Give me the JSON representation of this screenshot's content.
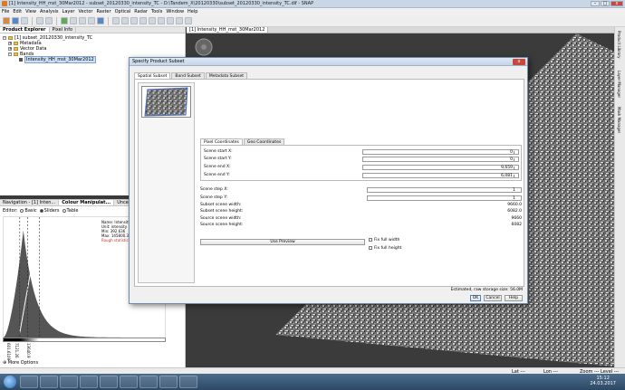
{
  "window": {
    "title": "[1] Intensity_HH_mst_30Mar2012 - subset_20120330_intensity_TC - D:\\Tandem_X\\20120330\\subset_20120330_intensity_TC.dif - SNAP",
    "min": "–",
    "max": "□",
    "close": "x"
  },
  "menu": [
    "File",
    "Edit",
    "View",
    "Analysis",
    "Layer",
    "Vector",
    "Raster",
    "Optical",
    "Radar",
    "Tools",
    "Window",
    "Help"
  ],
  "explorer": {
    "tabs": [
      "Product Explorer",
      "Pixel Info"
    ],
    "product": "[1] subset_20120330_intensity_TC",
    "metadata": "Metadata",
    "vector": "Vector Data",
    "bands": "Bands",
    "band": "Intensity_HH_mst_30Mar2012"
  },
  "colour": {
    "tabs": [
      "Navigation - [1] Inten...",
      "Colour Manipulat...",
      "Uncertainty Visuals..."
    ],
    "editor_label": "Editor:",
    "modes": [
      "Basic",
      "Sliders",
      "Table"
    ],
    "info": {
      "name": "Name: Intensity_...",
      "unit": "Unit: intensity",
      "min": "Min: 392.636",
      "max": "Max: 145800.322",
      "warn": "Rough statistics!"
    },
    "sliders": [
      "601.6109",
      "7121.26",
      "13640.9"
    ],
    "more": "More Options"
  },
  "view": {
    "tab": "[1] Intensity_HH_mst_30Mar2012"
  },
  "right_strip": [
    "Product Library",
    "Layer Manager",
    "Mask Manager"
  ],
  "status": {
    "ll": "Lat ---",
    "lon": "Lon ---",
    "zoom": "Zoom --- Level ---"
  },
  "clock": {
    "time": "15:12",
    "date": "24.03.2017"
  },
  "dialog": {
    "title": "Specify Product Subset",
    "tabs": [
      "Spatial Subset",
      "Band Subset",
      "Metadata Subset"
    ],
    "subtabs": [
      "Pixel Coordinates",
      "Geo Coordinates"
    ],
    "fields": [
      {
        "label": "Scene start X:",
        "value": "0"
      },
      {
        "label": "Scene start Y:",
        "value": "0"
      },
      {
        "label": "Scene end X:",
        "value": "9,659"
      },
      {
        "label": "Scene end Y:",
        "value": "6,081"
      }
    ],
    "steps": [
      {
        "label": "Scene step X:",
        "value": "1"
      },
      {
        "label": "Scene step Y:",
        "value": "1"
      }
    ],
    "info": [
      {
        "label": "Subset scene width:",
        "value": "9660.0"
      },
      {
        "label": "Subset scene height:",
        "value": "6082.0"
      },
      {
        "label": "Source scene width:",
        "value": "9660"
      },
      {
        "label": "Source scene height:",
        "value": "6082"
      }
    ],
    "use_preview": "Use Preview",
    "fix_width": "Fix full width",
    "fix_height": "Fix full height",
    "storage": "Estimated, raw storage size: 56.0M",
    "ok": "OK",
    "cancel": "Cancel",
    "help": "Help"
  }
}
